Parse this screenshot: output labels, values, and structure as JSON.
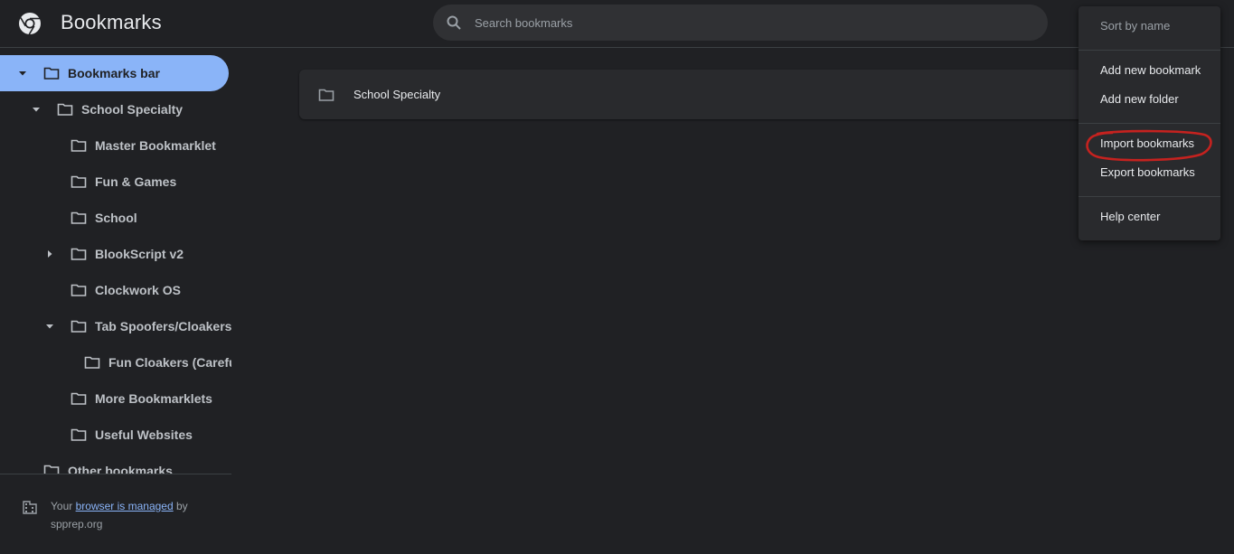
{
  "header": {
    "title": "Bookmarks",
    "logo_icon": "chrome-logo-icon"
  },
  "search": {
    "placeholder": "Search bookmarks",
    "value": ""
  },
  "sidebar": {
    "items": [
      {
        "label": "Bookmarks bar",
        "expanded": true,
        "selected": true
      },
      {
        "label": "School Specialty",
        "expanded": true
      },
      {
        "label": "Master Bookmarklet"
      },
      {
        "label": "Fun & Games"
      },
      {
        "label": "School"
      },
      {
        "label": "BlookScript v2",
        "expanded": false
      },
      {
        "label": "Clockwork OS"
      },
      {
        "label": "Tab Spoofers/Cloakers",
        "expanded": true
      },
      {
        "label": "Fun Cloakers (Careful"
      },
      {
        "label": "More Bookmarklets"
      },
      {
        "label": "Useful Websites"
      },
      {
        "label": "Other bookmarks"
      }
    ]
  },
  "managed": {
    "prefix": "Your ",
    "link": "browser is managed",
    "suffix": " by",
    "domain": "spprep.org"
  },
  "main": {
    "items": [
      {
        "label": "School Specialty"
      }
    ]
  },
  "menu": {
    "sort": "Sort by name",
    "add_bookmark": "Add new bookmark",
    "add_folder": "Add new folder",
    "import": "Import bookmarks",
    "export": "Export bookmarks",
    "help": "Help center"
  },
  "colors": {
    "background": "#202124",
    "accent": "#8ab4f8",
    "annotation": "#c5221f"
  }
}
